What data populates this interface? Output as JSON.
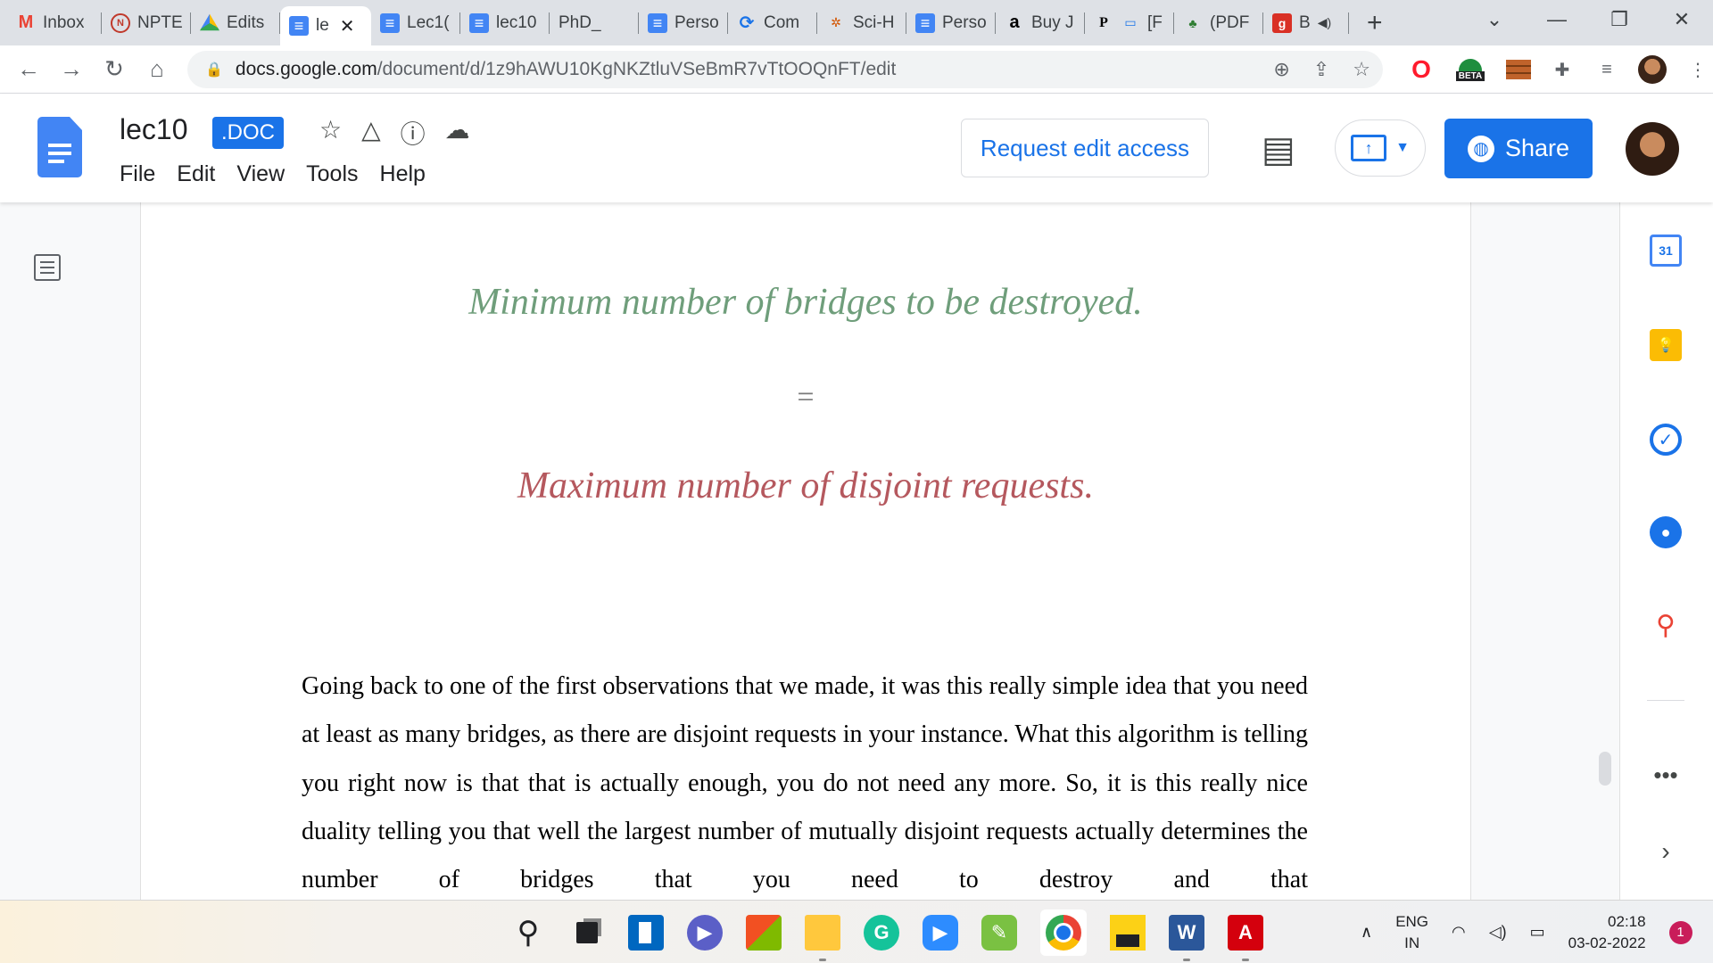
{
  "browser": {
    "tabs": [
      {
        "label": "Inbox",
        "icon": "gmail-icon"
      },
      {
        "label": "NPTE",
        "icon": "nptel-icon"
      },
      {
        "label": "Edits",
        "icon": "drive-icon"
      },
      {
        "label": "le",
        "icon": "docs-icon",
        "active": true
      },
      {
        "label": "Lec1(",
        "icon": "docs-icon"
      },
      {
        "label": "lec10",
        "icon": "docs-icon"
      },
      {
        "label": "PhD_",
        "icon": "page-icon"
      },
      {
        "label": "Perso",
        "icon": "docs-icon"
      },
      {
        "label": "Com",
        "icon": "link-icon"
      },
      {
        "label": "Sci-H",
        "icon": "scihub-icon"
      },
      {
        "label": "Perso",
        "icon": "docs-icon"
      },
      {
        "label": "Buy J",
        "icon": "amazon-icon"
      },
      {
        "label": "[F",
        "icon": "book-icon"
      },
      {
        "label": "(PDF",
        "icon": "pdf-icon"
      },
      {
        "label": "B",
        "icon": "grammar-icon"
      }
    ],
    "url_host": "docs.google.com",
    "url_path": "/document/d/1z9hAWU10KgNKZtluVSeBmR7vTtOOQnFT/edit",
    "beta_badge": "BETA"
  },
  "docs": {
    "title": "lec10",
    "badge": ".DOC",
    "menu": [
      "File",
      "Edit",
      "View",
      "Tools",
      "Help"
    ],
    "request_edit_label": "Request edit access",
    "share_label": "Share"
  },
  "document": {
    "line_green": "Minimum number of bridges to be destroyed.",
    "equals": "=",
    "line_red": "Maximum number of disjoint requests.",
    "paragraph": "Going back to one of the first observations that we made, it was this really simple idea that you need at least as many bridges, as there are disjoint requests in your instance. What this algorithm is telling you right now is that that is actually enough, you do not need any more. So, it is this really nice duality telling you that well the largest number of mutually disjoint requests actually determines the number of bridges that you need to destroy and that"
  },
  "side_panel": {
    "calendar_day": "31"
  },
  "taskbar": {
    "lang_top": "ENG",
    "lang_bottom": "IN",
    "time": "02:18",
    "date": "03-02-2022",
    "notifications": "1"
  },
  "colors": {
    "accent": "#1a73e8",
    "script_green": "#6f9e7b",
    "script_red": "#b5585e",
    "notification": "#c91d5a"
  }
}
